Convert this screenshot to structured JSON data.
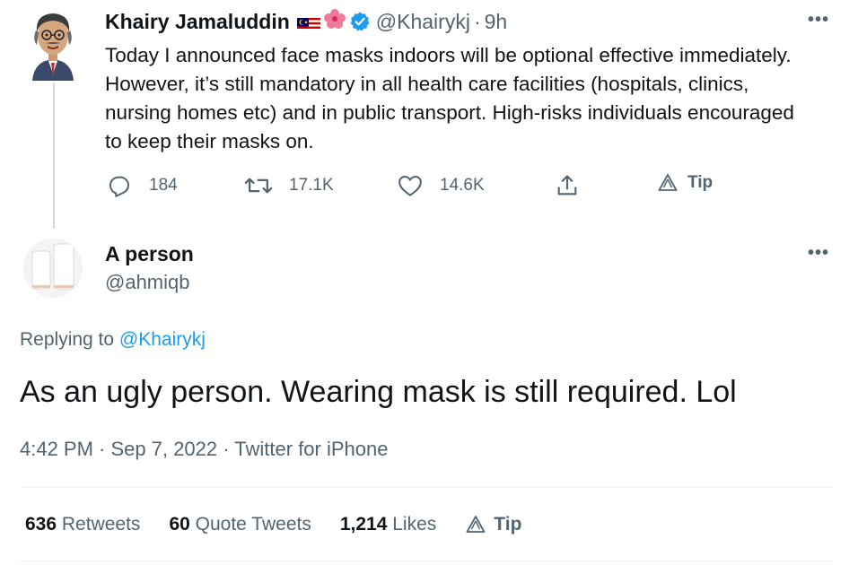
{
  "original_tweet": {
    "author_name": "Khairy Jamaluddin",
    "handle": "@Khairykj",
    "separator": "·",
    "time": "9h",
    "text": "Today I announced face masks indoors will be optional effective immediately. However, it’s still mandatory in all health care facilities (hospitals, clinics, nursing homes etc) and in public transport. High-risks individuals encouraged to keep their masks on.",
    "reply_count": "184",
    "retweet_count": "17.1K",
    "like_count": "14.6K",
    "tip_label": "Tip"
  },
  "reply_tweet": {
    "author_name": "A person",
    "handle": "@ahmiqb",
    "replying_prefix": "Replying to",
    "replying_to": "@Khairykj",
    "text": "As an ugly person. Wearing mask is still required. Lol",
    "timestamp": "4:42 PM · Sep 7, 2022 · Twitter for iPhone"
  },
  "stats": {
    "retweets_count": "636",
    "retweets_label": "Retweets",
    "quote_count": "60",
    "quote_label": "Quote Tweets",
    "likes_count": "1,214",
    "likes_label": "Likes",
    "tip_label": "Tip"
  },
  "icons": {
    "reply": "reply-icon",
    "retweet": "retweet-icon",
    "like": "heart-icon",
    "share": "share-icon",
    "tip": "tip-icon",
    "verified": "verified-badge-icon",
    "more": "more-options-icon"
  },
  "colors": {
    "text": "#0f1419",
    "secondary": "#536471",
    "accent": "#1d9bf0",
    "divider": "#eff3f4"
  }
}
